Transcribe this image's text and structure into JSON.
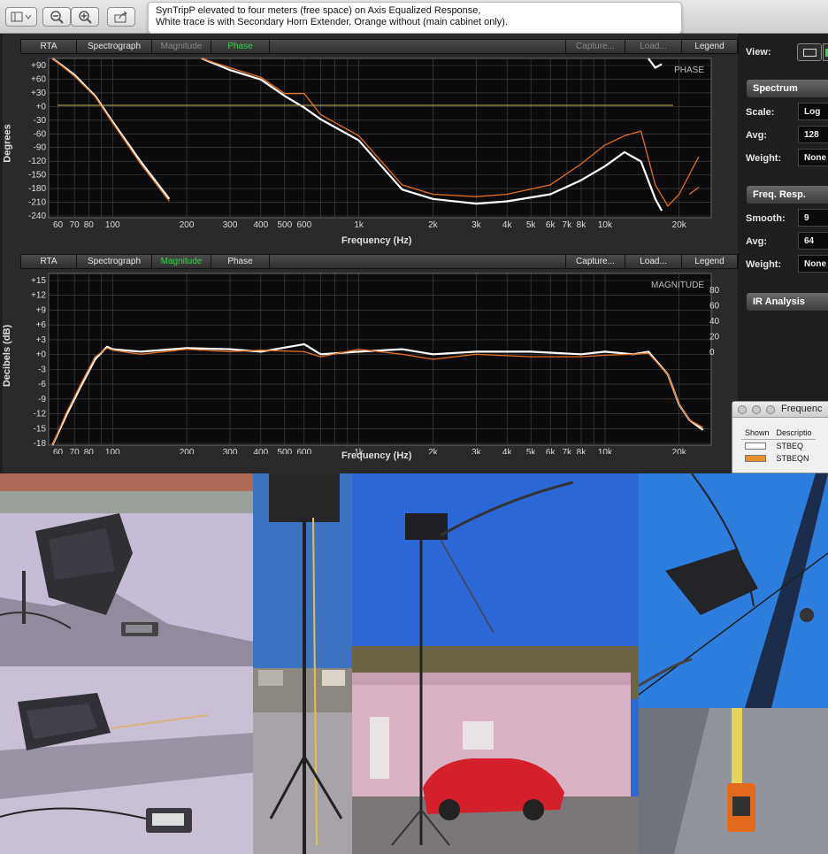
{
  "viewer": {
    "caption_line1": "SynTripP elevated to four meters (free space) on Axis Equalized Response,",
    "caption_line2": "White trace is with Secondary Horn Extender, Orange without (main cabinet only).",
    "buttons": [
      "sidebar-toggle-icon",
      "zoom-out-icon",
      "zoom-in-icon",
      "share-icon"
    ]
  },
  "colors": {
    "white_trace": "#ffffff",
    "orange_trace": "#e0711e",
    "active_tab": "#37d44a",
    "grid": "#4a4a4a"
  },
  "phase_panel": {
    "tabs": [
      "RTA",
      "Spectrograph",
      "Magnitude",
      "Phase",
      "Capture...",
      "Load...",
      "Legend"
    ],
    "active_tab": "Phase",
    "overlay": "PHASE",
    "ylabel": "Degrees",
    "xlabel": "Frequency (Hz)",
    "yticks": [
      "+90",
      "+60",
      "+30",
      "+0",
      "-30",
      "-60",
      "-90",
      "-120",
      "-150",
      "-180",
      "-210",
      "-240"
    ]
  },
  "magnitude_panel": {
    "tabs": [
      "RTA",
      "Spectrograph",
      "Magnitude",
      "Phase",
      "Capture...",
      "Load...",
      "Legend"
    ],
    "active_tab": "Magnitude",
    "overlay": "MAGNITUDE",
    "ylabel": "Decibels (dB)",
    "xlabel": "Frequency (Hz)",
    "yticks": [
      "+15",
      "+12",
      "+9",
      "+6",
      "+3",
      "+0",
      "-3",
      "-6",
      "-9",
      "-12",
      "-15",
      "-18"
    ],
    "yticks_right": [
      "80",
      "60",
      "40",
      "20",
      "0"
    ]
  },
  "xticks": [
    "60",
    "70",
    "80",
    "100",
    "200",
    "300",
    "400",
    "500",
    "600",
    "1k",
    "2k",
    "3k",
    "4k",
    "5k",
    "6k",
    "7k",
    "8k",
    "10k",
    "20k"
  ],
  "side": {
    "view_label": "View:",
    "spectrum_header": "Spectrum",
    "scale_label": "Scale:",
    "scale_value": "Log",
    "avg_label": "Avg:",
    "avg_value": "128",
    "weight_label": "Weight:",
    "weight_value": "None",
    "freq_header": "Freq. Resp.",
    "smooth_label": "Smooth:",
    "smooth_value": "9",
    "avg2_label": "Avg:",
    "avg2_value": "64",
    "weight2_label": "Weight:",
    "weight2_value": "None",
    "ir_header": "IR Analysis"
  },
  "legend_window": {
    "title": "Frequenc",
    "col_shown": "Shown",
    "col_desc": "Descriptio",
    "rows": [
      {
        "name": "STBEQ",
        "color": "#ffffff"
      },
      {
        "name": "STBEQN",
        "color": "#e8902e"
      }
    ]
  },
  "chart_data": [
    {
      "type": "line",
      "title": "",
      "xlabel": "Frequency (Hz)",
      "ylabel": "Degrees",
      "xscale": "log",
      "ylim": [
        -240,
        100
      ],
      "series": [
        {
          "x": [
            57,
            70,
            85,
            100,
            130,
            170
          ],
          "y": [
            100,
            65,
            20,
            -35,
            -120,
            -200
          ]
        },
        {
          "x": [
            230,
            300,
            400,
            500,
            600,
            700,
            1000,
            1500,
            2000,
            3000,
            4000,
            6000,
            8000,
            10000,
            12000,
            14000,
            16000,
            17000
          ],
          "y": [
            100,
            75,
            55,
            20,
            -5,
            -30,
            -75,
            -180,
            -200,
            -210,
            -205,
            -190,
            -160,
            -130,
            -100,
            -120,
            -200,
            -225
          ]
        },
        {
          "x": [
            15000,
            16000,
            17000
          ],
          "y": [
            100,
            80,
            88
          ]
        },
        {
          "x": [
            57,
            70,
            85,
            100,
            130,
            170
          ],
          "y": [
            100,
            62,
            18,
            -38,
            -125,
            -205
          ]
        },
        {
          "x": [
            230,
            300,
            400,
            500,
            600,
            700,
            1000,
            1500,
            2000,
            3000,
            4000,
            6000,
            8000,
            10000,
            12000,
            14000,
            16000,
            18000,
            20000,
            24000
          ],
          "y": [
            100,
            80,
            60,
            25,
            25,
            -20,
            -65,
            -170,
            -190,
            -195,
            -190,
            -170,
            -125,
            -85,
            -65,
            -55,
            -170,
            -215,
            -190,
            -110
          ]
        },
        {
          "x": [
            22000,
            24000
          ],
          "y": [
            -190,
            -175
          ]
        }
      ]
    },
    {
      "type": "line",
      "title": "",
      "xlabel": "Frequency (Hz)",
      "ylabel": "Decibels (dB)",
      "xscale": "log",
      "ylim": [
        -18,
        16
      ],
      "series": [
        {
          "x": [
            57,
            65,
            75,
            85,
            95,
            100,
            130,
            200,
            300,
            400,
            600,
            700,
            1000,
            1500,
            2000,
            3000,
            5000,
            8000,
            10000,
            13000,
            15000,
            18000,
            20000,
            22000,
            25000
          ],
          "y": [
            -18,
            -12,
            -6,
            -1,
            1.5,
            1,
            0.5,
            1.2,
            1,
            0.5,
            2,
            0,
            0.5,
            1,
            0,
            0.5,
            0.5,
            0,
            0.5,
            0,
            0.5,
            -4,
            -10,
            -13,
            -15
          ]
        },
        {
          "x": [
            57,
            65,
            75,
            85,
            95,
            100,
            130,
            200,
            300,
            400,
            600,
            700,
            1000,
            1500,
            2000,
            3000,
            5000,
            8000,
            10000,
            13000,
            15000,
            18000,
            20000,
            22000,
            25000
          ],
          "y": [
            -18,
            -11.5,
            -5.5,
            -0.5,
            1.2,
            0.8,
            0,
            1,
            0.5,
            0.8,
            0.5,
            -0.5,
            1,
            0,
            -1,
            0,
            -0.5,
            -0.5,
            -0.2,
            0,
            0.2,
            -4,
            -10,
            -13,
            -14.5
          ]
        }
      ]
    }
  ]
}
